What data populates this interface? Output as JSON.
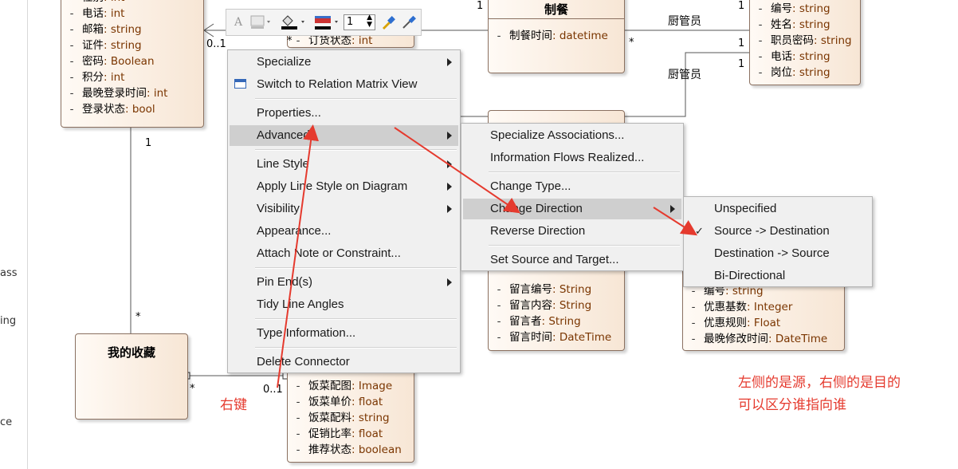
{
  "left_strip": {
    "texts": [
      "ass",
      "ing",
      "ce"
    ]
  },
  "classes": {
    "user": {
      "attrs": [
        {
          "name": "性别",
          "type": "int"
        },
        {
          "name": "电话",
          "type": "int"
        },
        {
          "name": "邮箱",
          "type": "string"
        },
        {
          "name": "证件",
          "type": "string"
        },
        {
          "name": "密码",
          "type": "Boolean"
        },
        {
          "name": "积分",
          "type": "int"
        },
        {
          "name": "最晚登录时间",
          "type": "int"
        },
        {
          "name": "登录状态",
          "type": "bool"
        }
      ]
    },
    "cooking": {
      "title": "制餐",
      "attrs": [
        {
          "name": "制餐时间",
          "type": "datetime"
        }
      ]
    },
    "chef": {
      "attrs": [
        {
          "name": "编号",
          "type": "string"
        },
        {
          "name": "姓名",
          "type": "string"
        },
        {
          "name": "职员密码",
          "type": "string"
        },
        {
          "name": "电话",
          "type": "string"
        },
        {
          "name": "岗位",
          "type": "string"
        }
      ]
    },
    "order_partial": {
      "attrs": [
        {
          "name": "订货状态",
          "type": "int"
        }
      ]
    },
    "favorites": {
      "title": "我的收藏"
    },
    "dish": {
      "attrs": [
        {
          "name": "饭菜配图",
          "type": "Image"
        },
        {
          "name": "饭菜单价",
          "type": "float"
        },
        {
          "name": "饭菜配料",
          "type": "string"
        },
        {
          "name": "促销比率",
          "type": "float"
        },
        {
          "name": "推荐状态",
          "type": "boolean"
        }
      ]
    },
    "message": {
      "attrs": [
        {
          "name": "留言编号",
          "type": "String"
        },
        {
          "name": "留言内容",
          "type": "String"
        },
        {
          "name": "留言者",
          "type": "String"
        },
        {
          "name": "留言时间",
          "type": "DateTime"
        }
      ]
    },
    "discount": {
      "attrs": [
        {
          "name": "编号",
          "type": "string"
        },
        {
          "name": "优惠基数",
          "type": "Integer"
        },
        {
          "name": "优惠规则",
          "type": "Float"
        },
        {
          "name": "最晚修改时间",
          "type": "DateTime"
        }
      ]
    }
  },
  "multiplicities": {
    "user_left": "0..1",
    "user_bottom": "1",
    "fav_top": "*",
    "fav_right": "*",
    "dish_top": "0..1",
    "cooking_left": "*",
    "cooking_right": "*",
    "order_one": "1",
    "order_star": "*",
    "chef_top": "1",
    "chef_mid1": "1",
    "chef_mid2": "1"
  },
  "roles": {
    "role1": "厨管员",
    "role2": "厨管员"
  },
  "toolbar": {
    "line_width_value": "1"
  },
  "context_menu": {
    "items": [
      {
        "label": "Specialize",
        "submenu": true
      },
      {
        "label": "Switch to Relation Matrix View",
        "submenu": false
      },
      {
        "label": "Properties...",
        "submenu": false
      },
      {
        "label": "Advanced",
        "submenu": true,
        "highlighted": true
      },
      {
        "label": "Line Style",
        "submenu": true
      },
      {
        "label": "Apply Line Style on Diagram",
        "submenu": true
      },
      {
        "label": "Visibility",
        "submenu": true
      },
      {
        "label": "Appearance...",
        "submenu": false
      },
      {
        "label": "Attach Note or Constraint...",
        "submenu": false
      },
      {
        "label": "Pin End(s)",
        "submenu": true
      },
      {
        "label": "Tidy Line Angles",
        "submenu": false
      },
      {
        "label": "Type Information...",
        "submenu": false
      },
      {
        "label": "Delete Connector",
        "submenu": false
      }
    ]
  },
  "advanced_menu": {
    "items": [
      {
        "label": "Specialize Associations..."
      },
      {
        "label": "Information Flows Realized..."
      },
      {
        "label": "Change Type..."
      },
      {
        "label": "Change Direction",
        "submenu": true,
        "highlighted": true
      },
      {
        "label": "Reverse Direction"
      },
      {
        "label": "Set Source and Target..."
      }
    ]
  },
  "direction_menu": {
    "items": [
      {
        "label": "Unspecified",
        "checked": false
      },
      {
        "label": "Source -> Destination",
        "checked": true
      },
      {
        "label": "Destination -> Source",
        "checked": false
      },
      {
        "label": "Bi-Directional",
        "checked": false
      }
    ],
    "check_mark": "✓"
  },
  "annotations": {
    "right_click": "右键",
    "note_line1": "左侧的是源，右侧的是目的",
    "note_line2": "可以区分谁指向谁"
  },
  "colors": {
    "annotation": "#e53a2e",
    "class_fill": "#f7e6d5",
    "type_text": "#7a3500"
  }
}
